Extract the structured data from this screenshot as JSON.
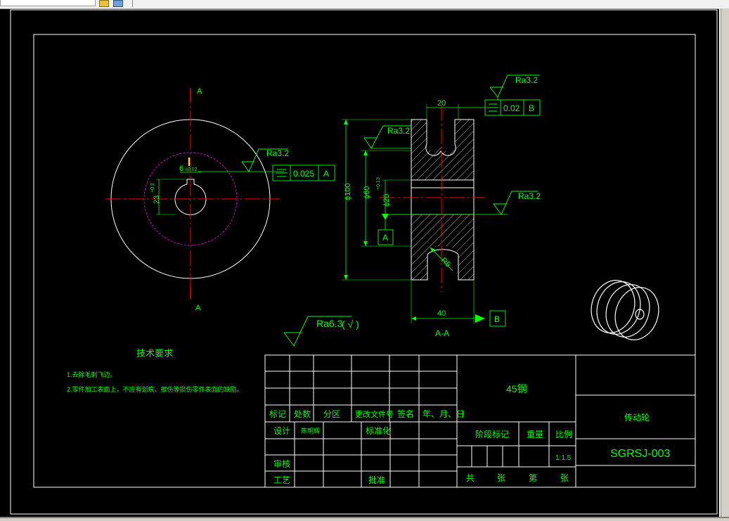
{
  "drawing": {
    "section_label_top": "A",
    "section_label_bottom": "A",
    "section_view_label": "A-A",
    "roughness_left": "Ra3.2",
    "roughness_top": "Ra3.2",
    "roughness_mid": "Ra3.2",
    "roughness_right": "Ra3.2",
    "roughness_general": "Ra6.3",
    "roughness_general_note": "( √ )",
    "tol_left_value": "0.025",
    "tol_left_datum": "A",
    "tol_top_value": "0.02",
    "tol_top_datum": "B",
    "datum_a": "A",
    "datum_b": "B",
    "dim_keyway_width": "6",
    "dim_keyway_width_tol": "±0.02",
    "dim_keyway_depth": "23",
    "dim_keyway_depth_tol": "+0.2",
    "dim_groove_width": "20",
    "dim_outer_dia": "ϕ100",
    "dim_hub_dia": "ϕ60",
    "dim_bore_dia": "ϕ20",
    "dim_bore_tol": "+0.13",
    "dim_radius": "R5",
    "dim_total_width": "40"
  },
  "tech_requirements": {
    "title": "技术要求",
    "item1": "1.去除毛刺飞边。",
    "item2": "2.零件加工表面上，不应有划痕、擦伤等损伤零件表面的缺陷。"
  },
  "title_block": {
    "material": "45钢",
    "part_name": "传动轮",
    "drawing_number": "SGRSJ-003",
    "h_mark": "标记",
    "h_count": "处数",
    "h_zone": "分区",
    "h_doc": "更改文件号",
    "h_sign": "签名",
    "h_date": "年、月、日",
    "design": "设计",
    "designer": "陈明辉",
    "standardize": "标准化",
    "check": "审核",
    "process": "工艺",
    "approve": "批准",
    "stage_mark": "阶段标记",
    "weight": "重量",
    "scale_label": "比例",
    "scale_value": "1:1.5",
    "total": "共",
    "sheets": "张",
    "sheet_no": "第",
    "sheets2": "张"
  },
  "colors": {
    "background": "#000000",
    "outline": "#ffffff",
    "dimension": "#00ff00",
    "centerline": "#ff0000",
    "hidden_circle": "#cc00cc",
    "text_green": "#00ff00",
    "hatch": "#ffffff",
    "keyway_mark": "#ffff00"
  },
  "icons": [
    "layer-icon",
    "block-icon"
  ]
}
